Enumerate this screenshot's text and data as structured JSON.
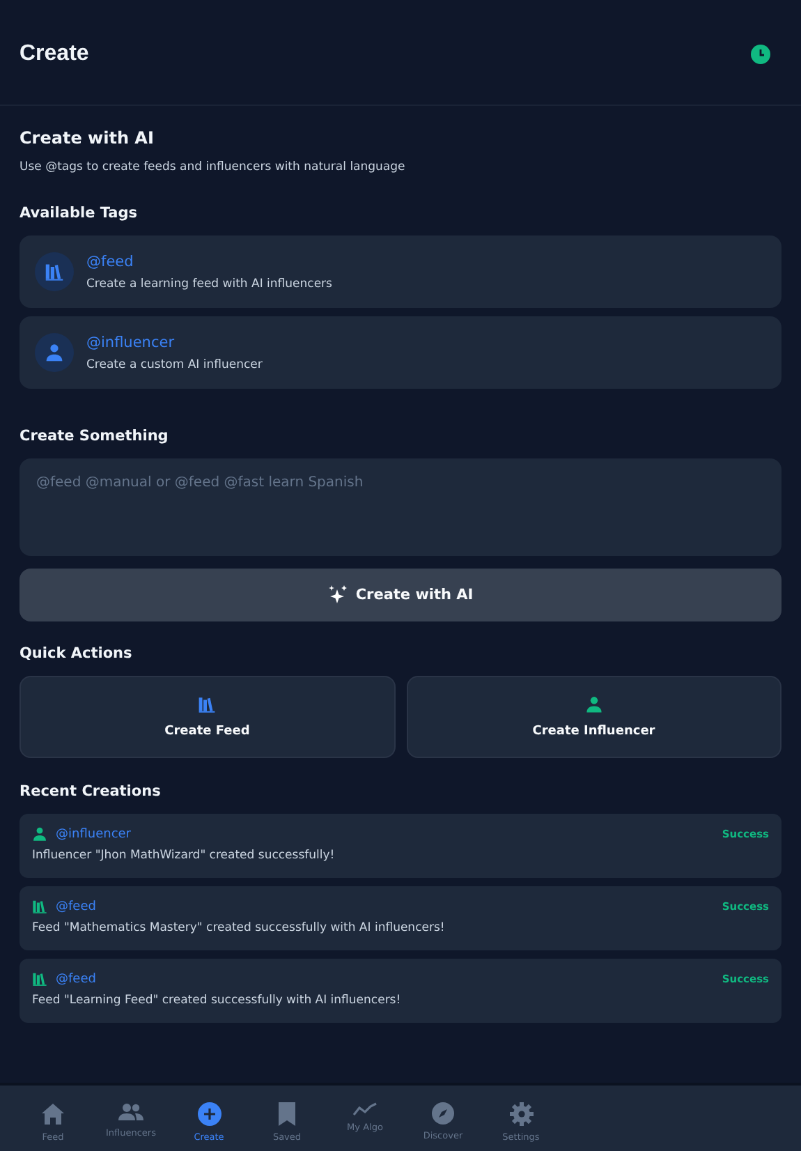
{
  "header": {
    "title": "Create"
  },
  "intro": {
    "title": "Create with AI",
    "subtitle": "Use @tags to create feeds and influencers with natural language"
  },
  "available_tags": {
    "title": "Available Tags",
    "items": [
      {
        "kind": "feed",
        "tag": "@feed",
        "description": "Create a learning feed with AI influencers"
      },
      {
        "kind": "influencer",
        "tag": "@influencer",
        "description": "Create a custom AI influencer"
      }
    ]
  },
  "create_something": {
    "title": "Create Something",
    "placeholder": "@feed @manual or @feed @fast learn Spanish",
    "button": "Create with AI"
  },
  "quick_actions": {
    "title": "Quick Actions",
    "items": [
      {
        "kind": "feed",
        "label": "Create Feed"
      },
      {
        "kind": "influencer",
        "label": "Create Influencer"
      }
    ]
  },
  "recent_creations": {
    "title": "Recent Creations",
    "items": [
      {
        "kind": "influencer",
        "tag": "@influencer",
        "status": "Success",
        "message": "Influencer \"Jhon MathWizard\" created successfully!"
      },
      {
        "kind": "feed",
        "tag": "@feed",
        "status": "Success",
        "message": "Feed \"Mathematics Mastery\" created successfully with AI influencers!"
      },
      {
        "kind": "feed",
        "tag": "@feed",
        "status": "Success",
        "message": "Feed \"Learning Feed\" created successfully with AI influencers!"
      }
    ]
  },
  "bottom_nav": [
    {
      "kind": "home",
      "label": "Feed",
      "selected": false
    },
    {
      "kind": "people",
      "label": "Influencers",
      "selected": false
    },
    {
      "kind": "plus",
      "label": "Create",
      "selected": true
    },
    {
      "kind": "bookmark",
      "label": "Saved",
      "selected": false
    },
    {
      "kind": "trend",
      "label": "My Algo",
      "selected": false
    },
    {
      "kind": "compass",
      "label": "Discover",
      "selected": false
    },
    {
      "kind": "gear",
      "label": "Settings",
      "selected": false
    }
  ]
}
